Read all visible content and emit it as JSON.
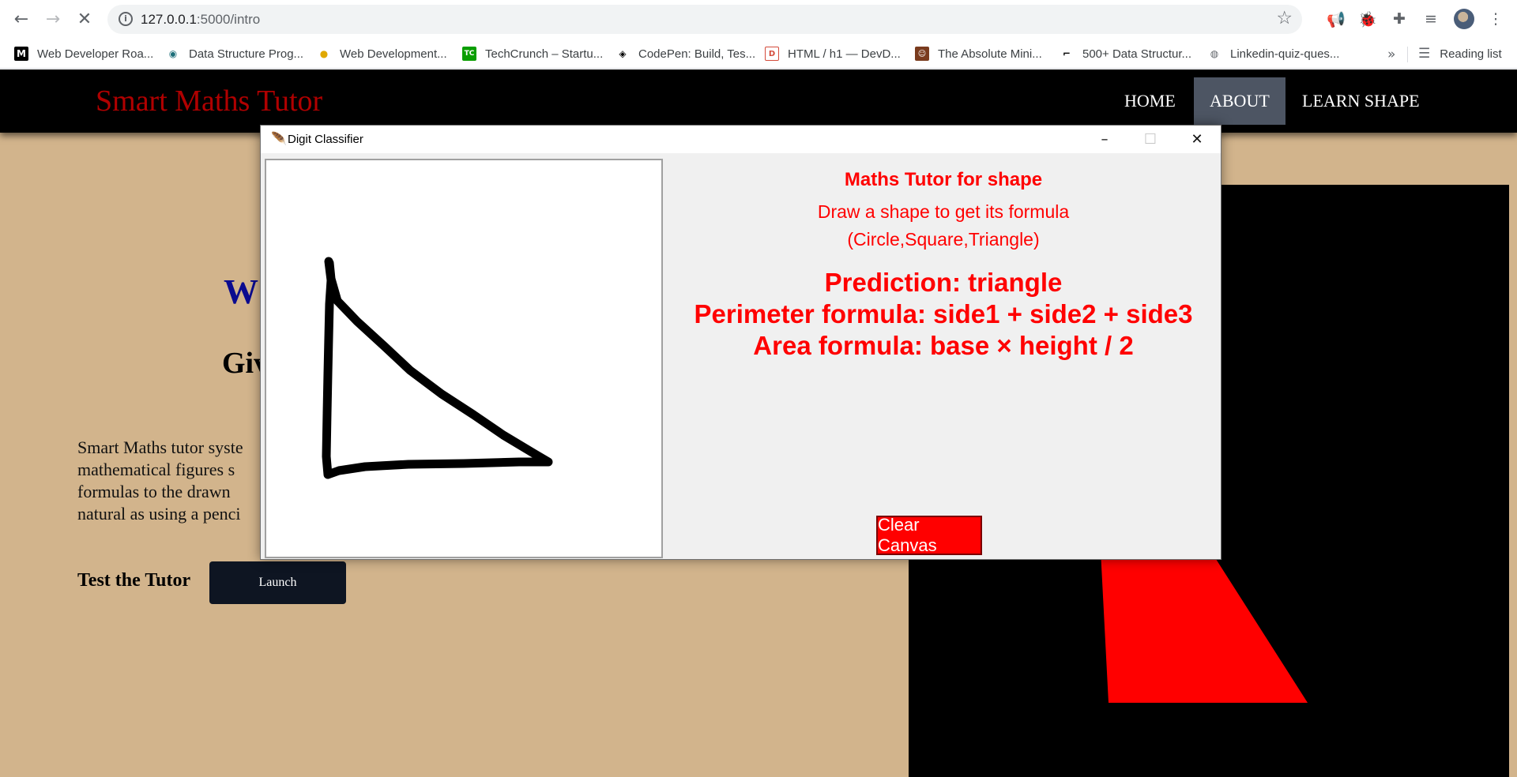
{
  "browser": {
    "url_host": "127.0.0.1",
    "url_path": ":5000/intro",
    "bookmarks": [
      {
        "label": "Web Developer Roa...",
        "icon": "medium-icon",
        "color": "#000000"
      },
      {
        "label": "Data Structure Prog...",
        "icon": "programiz-icon",
        "color": "#1e6f7a"
      },
      {
        "label": "Web Development...",
        "icon": "bulb-icon",
        "color": "#e0a800"
      },
      {
        "label": "TechCrunch – Startu...",
        "icon": "techcrunch-icon",
        "color": "#0a9e01"
      },
      {
        "label": "CodePen: Build, Tes...",
        "icon": "codepen-icon",
        "color": "#000000"
      },
      {
        "label": "HTML / h1 — DevD...",
        "icon": "devdocs-icon",
        "color": "#d44b3b"
      },
      {
        "label": "The Absolute Mini...",
        "icon": "person-icon",
        "color": "#7a3b1e"
      },
      {
        "label": "500+ Data Structur...",
        "icon": "bracket-icon",
        "color": "#000000"
      },
      {
        "label": "Linkedin-quiz-ques...",
        "icon": "globe-icon",
        "color": "#5f6368"
      }
    ],
    "reading_list": "Reading list"
  },
  "site": {
    "brand": "Smart Maths Tutor",
    "nav": [
      "HOME",
      "ABOUT",
      "LEARN SHAPE"
    ],
    "active_nav": "ABOUT",
    "hero_partial": "W",
    "subhead_partial": "Giv",
    "intro_lines": [
      "Smart Maths tutor syste",
      "mathematical figures s",
      "formulas to the drawn",
      "natural as using a penci"
    ],
    "test_label": "Test the Tutor",
    "launch_label": "Launch",
    "accent_red": "#ff0000",
    "page_bg": "#d2b48c"
  },
  "tk": {
    "title": "Digit Classifier",
    "heading": "Maths Tutor for shape",
    "instruction": "Draw a shape to get its formula",
    "shapes": "(Circle,Square,Triangle)",
    "prediction": "Prediction: triangle",
    "perimeter": "Perimeter formula: side1 + side2 + side3",
    "area": "Area formula: base × height / 2",
    "clear_button": "Clear Canvas"
  }
}
